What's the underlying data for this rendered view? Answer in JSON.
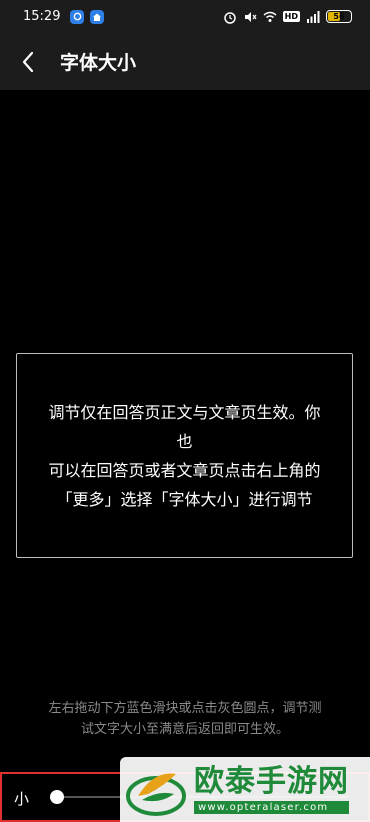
{
  "status_bar": {
    "time": "15:29",
    "hd": "HD",
    "battery_level": "56"
  },
  "header": {
    "title": "字体大小"
  },
  "preview": {
    "line1": "调节仅在回答页正文与文章页生效。你也",
    "line2": "可以在回答页或者文章页点击右上角的",
    "line3": "「更多」选择「字体大小」进行调节"
  },
  "hint": {
    "line1": "左右拖动下方蓝色滑块或点击灰色圆点，调节测",
    "line2": "试文字大小至满意后返回即可生效。"
  },
  "slider": {
    "label": "小"
  },
  "watermark": {
    "name": "欧泰手游网",
    "url": "www.opteralaser.com"
  },
  "colors": {
    "background": "#000000",
    "bar": "#1c1c1c",
    "highlight_border": "#e03030",
    "watermark_green": "#1f8a3a",
    "battery": "#e2b600"
  }
}
